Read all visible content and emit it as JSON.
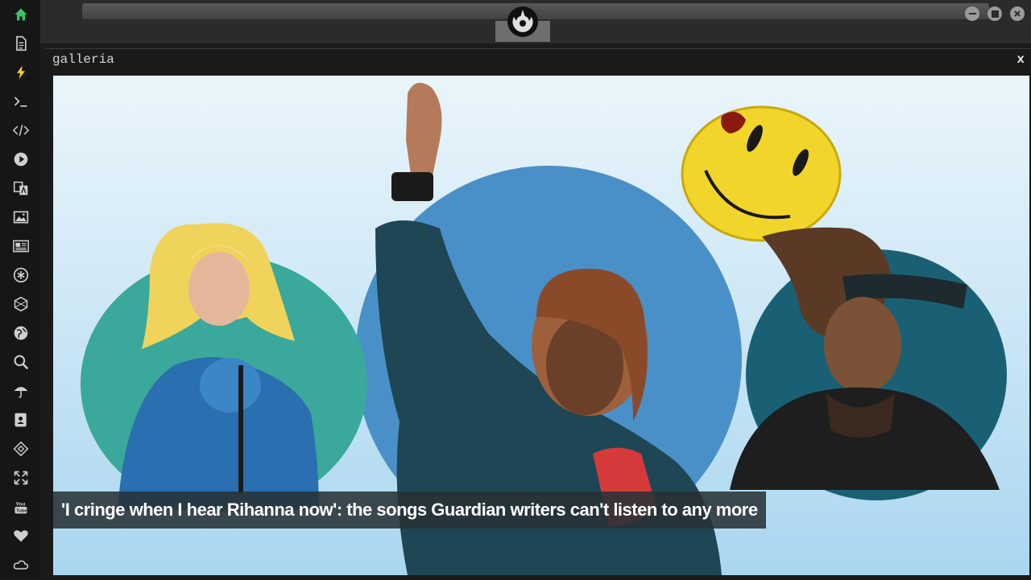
{
  "window": {
    "panel_title": "galleria",
    "close_label": "x"
  },
  "gallery": {
    "caption": "'I cringe when I hear Rihanna now': the songs Guardian writers can't listen to any more"
  },
  "sidebar": {
    "icons": [
      "home-icon",
      "document-icon",
      "lightning-icon",
      "terminal-icon",
      "code-icon",
      "play-icon",
      "translate-icon",
      "image-icon",
      "news-icon",
      "asterisk-icon",
      "hexagon-icon",
      "globe-icon",
      "search-icon",
      "umbrella-icon",
      "contact-icon",
      "diamond-icon",
      "expand-icon",
      "youtube-icon",
      "heart-icon",
      "cloud-icon"
    ]
  },
  "colors": {
    "accent": "#3ac36a",
    "lightning": "#f2d027",
    "sidebar_bg": "#161616"
  }
}
